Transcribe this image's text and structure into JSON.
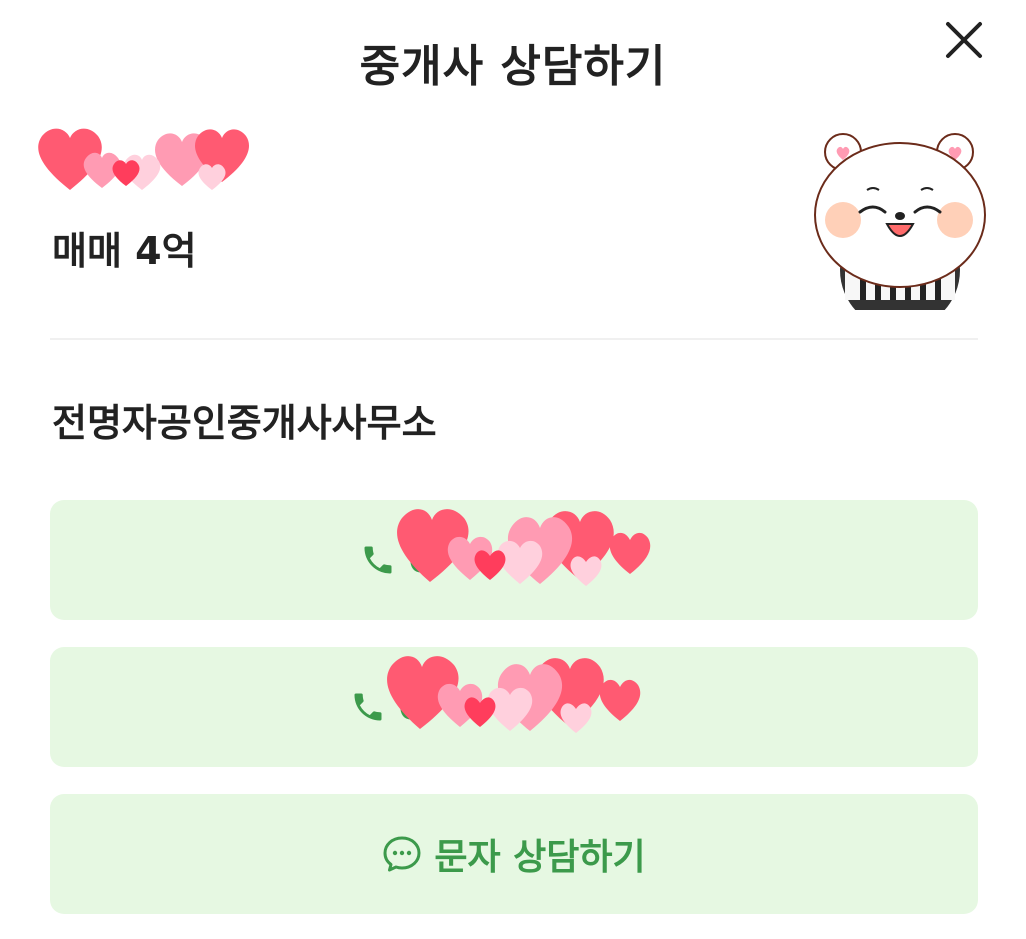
{
  "header": {
    "title": "중개사 상담하기",
    "close_icon": "close-icon"
  },
  "property": {
    "subtitle": "",
    "price": "매매 4억"
  },
  "agency": {
    "name": "전명자공인중개사사무소"
  },
  "actions": {
    "phone_1": "0",
    "phone_2": "0",
    "sms_label": "문자 상담하기"
  },
  "colors": {
    "accent_green": "#3c9a4b",
    "button_bg": "#e6f8e2",
    "text": "#222222"
  },
  "icons": {
    "phone": "phone-icon",
    "chat": "chat-bubble-icon",
    "avatar": "bear-avatar",
    "redaction": "hearts-sticker"
  }
}
